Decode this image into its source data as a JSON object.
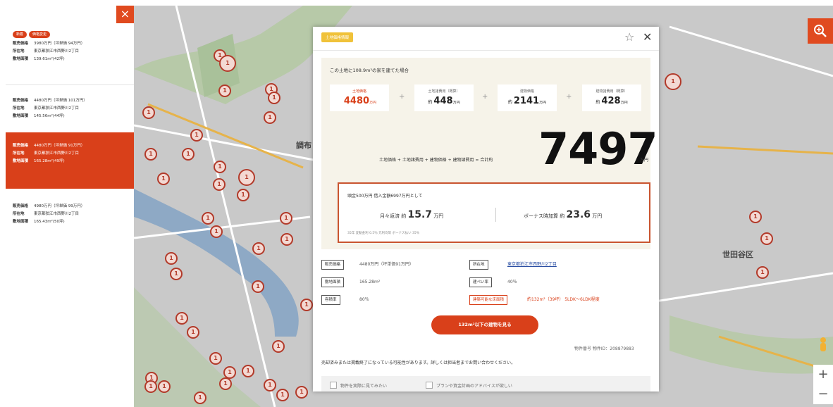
{
  "left_panel": {
    "close_label": "×",
    "badges": [
      "新着",
      "価格変更"
    ],
    "listings": [
      {
        "rows": [
          {
            "k": "販売価格",
            "v": "3980万円（坪単価 94万円）"
          },
          {
            "k": "所在地",
            "v": "東京都狛江市西野川2丁目"
          },
          {
            "k": "敷地面積",
            "v": "139.61m²(42坪)"
          }
        ]
      },
      {
        "rows": [
          {
            "k": "販売価格",
            "v": "4480万円（坪単価 101万円）"
          },
          {
            "k": "所在地",
            "v": "東京都狛江市西野川2丁目"
          },
          {
            "k": "敷地面積",
            "v": "145.56m²(44坪)"
          }
        ]
      },
      {
        "rows": [
          {
            "k": "販売価格",
            "v": "4480万円（坪単価 91万円）"
          },
          {
            "k": "所在地",
            "v": "東京都狛江市西野川2丁目"
          },
          {
            "k": "敷地面積",
            "v": "165.28m²(49坪)"
          }
        ]
      },
      {
        "rows": [
          {
            "k": "販売価格",
            "v": "4980万円（坪単価 99万円）"
          },
          {
            "k": "所在地",
            "v": "東京都狛江市西野川2丁目"
          },
          {
            "k": "敷地面積",
            "v": "165.43m²(50坪)"
          }
        ]
      }
    ]
  },
  "modal": {
    "tag": "土地価格情報",
    "star": "☆",
    "close": "✕",
    "calc_title": "この土地に108.9m²の家を建てた場合",
    "boxes": [
      {
        "label": "土地価格",
        "prefix": "",
        "value": "4480",
        "unit": "万円"
      },
      {
        "label": "土地諸費用（概算）",
        "prefix": "約",
        "value": "448",
        "unit": "万円"
      },
      {
        "label": "建物価格",
        "prefix": "約",
        "value": "2141",
        "unit": "万円"
      },
      {
        "label": "建物諸費用（概算）",
        "prefix": "約",
        "value": "428",
        "unit": "万円"
      }
    ],
    "plus": "+",
    "formula": "土地価格 + 土地諸費用 + 建物価格 + 建物諸費用 = 合計約",
    "total": "7497",
    "total_unit": "万円",
    "loan": {
      "condition": "頭金500万円 借入金額6997万円として",
      "monthly_label": "月々返済 約",
      "monthly_value": "15.7",
      "monthly_unit": "万円",
      "bonus_label": "ボーナス時加算 約",
      "bonus_value": "23.6",
      "bonus_unit": "万円",
      "note": "35年 変動金利 0.5％ 元利均等 ボーナス払い 35％"
    },
    "attrs": [
      {
        "label": "販売価格",
        "value": "4480万円（坪単価91万円）"
      },
      {
        "label": "所在地",
        "value": "東京都狛江市西野川2丁目"
      },
      {
        "label": "敷地面積",
        "value": "165.28m²"
      },
      {
        "label": "建ぺい率",
        "value": "40％"
      },
      {
        "label": "容積率",
        "value": "80％"
      },
      {
        "label": "建築可能な床面積",
        "value": "約132m²（39坪） 5LDK〜6LDK程度"
      }
    ],
    "cta": "132m²以下の建物を見る",
    "prop_id": "物件番号 物件ID：208879883",
    "notice": "売却済みまたは掲載終了になっている可能性があります。詳しくは担当者までお問い合わせください。",
    "checks": [
      "物件を実際に見てみたい",
      "プランや資金計画のアドバイスが欲しい"
    ]
  },
  "map": {
    "labels": [
      "調布",
      "世田谷区"
    ],
    "pins": [
      "1",
      "1",
      "1",
      "1",
      "1",
      "1",
      "1",
      "1",
      "1",
      "1",
      "1",
      "1",
      "1",
      "1",
      "1",
      "1",
      "1",
      "1",
      "1",
      "1",
      "1",
      "1",
      "1",
      "1",
      "1",
      "1",
      "1",
      "1",
      "1",
      "1",
      "1",
      "1",
      "1",
      "1",
      "1",
      "1",
      "1",
      "1",
      "1",
      "1",
      "1",
      "1"
    ],
    "zoom_in": "+",
    "zoom_out": "−"
  },
  "colors": {
    "accent": "#d9401a",
    "tag": "#f0c23a",
    "map": "#c8c8c8"
  }
}
